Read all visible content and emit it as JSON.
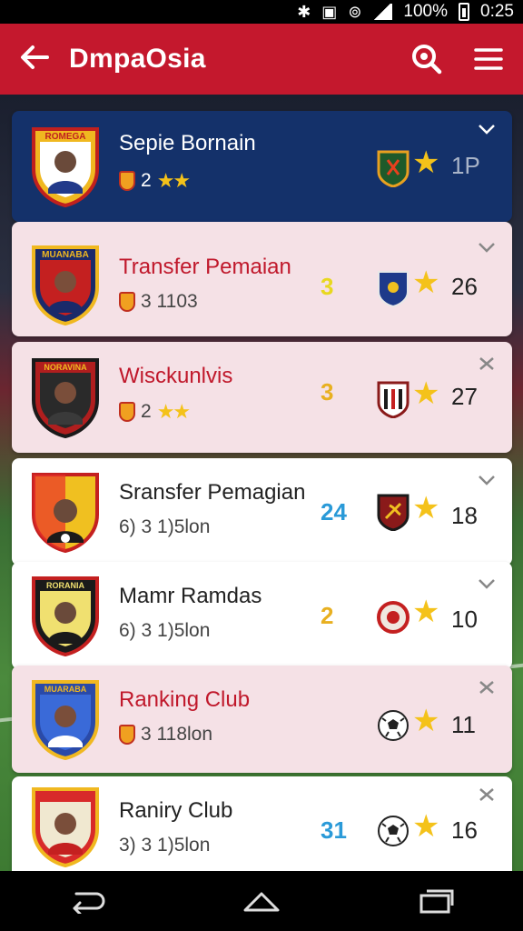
{
  "status_bar": {
    "battery": "100%",
    "time": "0:25"
  },
  "app_bar": {
    "title": "DmpaOsia"
  },
  "items": [
    {
      "name": "Sepie Bornain",
      "sub": "2",
      "stars": "★★",
      "rank": "",
      "score": "1P",
      "style": "navy",
      "name_color": "white",
      "club_icon": "shield-icon",
      "trailing_icon": "club-logo-icon"
    },
    {
      "name": "Transfer Pemaian",
      "sub": "3 1103",
      "stars": "",
      "rank": "3",
      "score": "26",
      "style": "pink",
      "name_color": "red",
      "club_icon": "shield-icon",
      "trailing_icon": "club-logo-icon"
    },
    {
      "name": "Wisckunlvis",
      "sub": "2",
      "stars": "★★",
      "rank": "3",
      "score": "27",
      "style": "pink",
      "name_color": "red",
      "club_icon": "shield-icon",
      "trailing_icon": "club-logo-icon"
    },
    {
      "name": "Sransfer Pemagian",
      "sub": "6) 3 1)5lon",
      "stars": "",
      "rank": "24",
      "score": "18",
      "style": "white",
      "name_color": "dark",
      "club_icon": "",
      "trailing_icon": "club-logo-icon"
    },
    {
      "name": "Mamr Ramdas",
      "sub": "6) 3 1)5lon",
      "stars": "",
      "rank": "2",
      "score": "10",
      "style": "white",
      "name_color": "dark",
      "club_icon": "",
      "trailing_icon": "club-logo-icon"
    },
    {
      "name": "Ranking Club",
      "sub": "3 118lon",
      "stars": "",
      "rank": "",
      "score": "11",
      "style": "pink",
      "name_color": "red",
      "club_icon": "shield-icon",
      "trailing_icon": "soccer-ball-icon"
    },
    {
      "name": "Raniry Club",
      "sub": "3) 3 1)5lon",
      "stars": "",
      "rank": "31",
      "score": "16",
      "style": "white",
      "name_color": "dark",
      "club_icon": "",
      "trailing_icon": "soccer-ball-icon"
    }
  ],
  "colors": {
    "app_bar": "#c4182d",
    "navy_card": "#14316a",
    "pink_card": "#f5e1e6",
    "star": "#f4c21a",
    "rank_colors": [
      "",
      "#e8d81e",
      "#e8b020",
      "#2a9ad8",
      "#e8b020",
      "",
      "#2a9ad8"
    ]
  },
  "crest_labels": [
    "ROMEGA",
    "MUANABA",
    "NORAVINA",
    "",
    "RORANIA",
    "MUARABA",
    ""
  ]
}
